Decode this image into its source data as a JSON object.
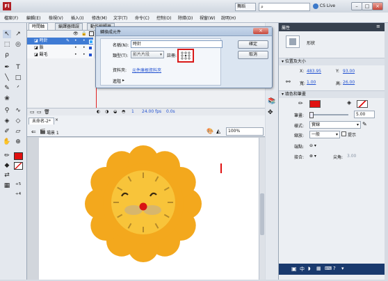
{
  "title_bar": {
    "mode": "舞蹈",
    "search_placeholder": "",
    "cs_live": "CS Live",
    "logo": "Fl"
  },
  "menu": [
    "檔案(F)",
    "編輯(E)",
    "檢視(V)",
    "插入(I)",
    "修改(M)",
    "文字(T)",
    "命令(C)",
    "控制(O)",
    "除錯(D)",
    "視窗(W)",
    "說明(H)"
  ],
  "timeline": {
    "tabs": [
      "時間軸",
      "編譯器錯誤",
      "動作編輯器"
    ],
    "layers": [
      {
        "name": "時針",
        "selected": true
      },
      {
        "name": "臉",
        "selected": false
      },
      {
        "name": "鬍毛",
        "selected": false
      }
    ],
    "frame_number": "1",
    "fps": "24.00 fps",
    "time": "0.0s"
  },
  "editbar": {
    "doc_tab": "未命名-2*",
    "scene": "場景 1",
    "zoom": "100%"
  },
  "dialog": {
    "title": "轉換成元件",
    "name_label": "名稱(N):",
    "name_value": "時針",
    "type_label": "類型(T):",
    "type_value": "影片片段",
    "registration_label": "註冊:",
    "folder_label": "資料夾:",
    "folder_value": "元件庫根資料夾",
    "advanced_label": "進階",
    "ok_label": "確定",
    "cancel_label": "取消"
  },
  "properties": {
    "tab": "屬性",
    "object_label": "形狀",
    "position_section": "位置及大小",
    "x_label": "X:",
    "x_value": "483.95",
    "y_label": "Y:",
    "y_value": "93.00",
    "w_label": "寬:",
    "w_value": "1.00",
    "h_label": "高:",
    "h_value": "26.00",
    "fill_section": "填色和筆畫",
    "stroke_label": "筆畫:",
    "stroke_value": "5.00",
    "style_label": "樣式:",
    "style_value": "實線",
    "scale_label": "縮放:",
    "scale_value": "一般",
    "hint_label": "提示",
    "cap_label": "端點:",
    "join_label": "接合:",
    "miter_label": "尖角:",
    "miter_value": "3.00"
  },
  "colors": {
    "stroke": "#e01010",
    "accent": "#e01010",
    "flower": "#f3a81d",
    "face": "#f8c43a",
    "muzzle": "#d7b66d",
    "nose": "#d91414"
  }
}
